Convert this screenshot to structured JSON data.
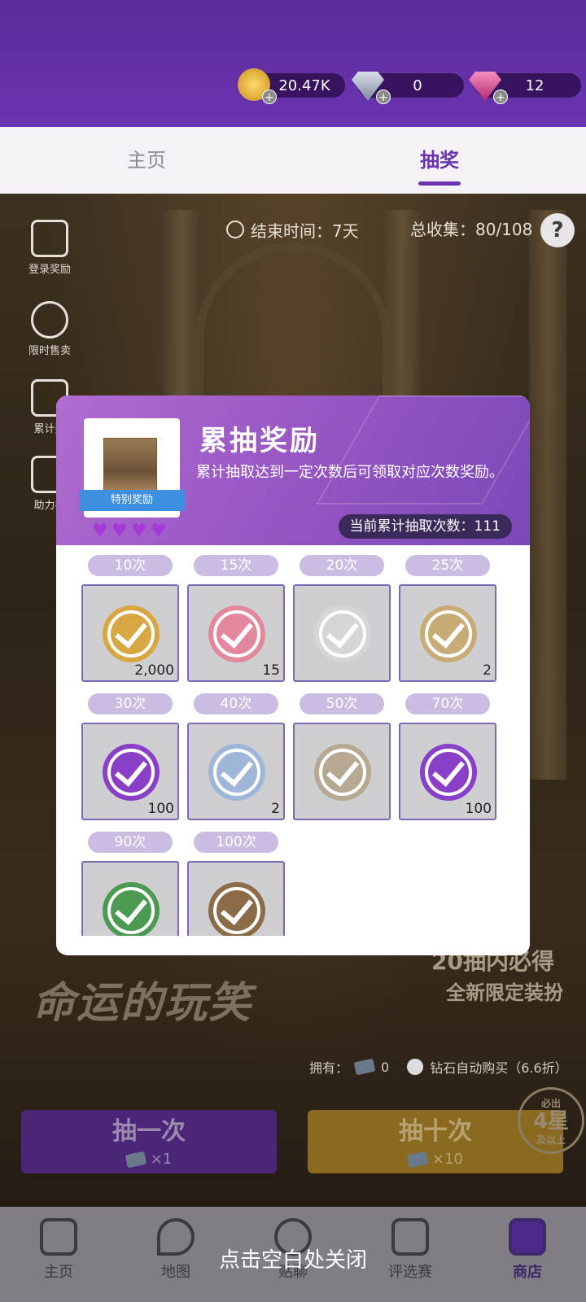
{
  "currencies": [
    {
      "name": "gold-coin",
      "value": "20.47K",
      "color": "#e7b43a"
    },
    {
      "name": "diamond",
      "value": "0",
      "color": "#b8c4d8"
    },
    {
      "name": "gem",
      "value": "12",
      "color": "#e06aa4"
    }
  ],
  "tabs": [
    {
      "label": "主页",
      "active": false
    },
    {
      "label": "抽奖",
      "active": true
    }
  ],
  "event": {
    "end_time": "结束时间：7天",
    "collection": "总收集：80/108",
    "help": "?"
  },
  "side_buttons": [
    {
      "label": "登录奖励",
      "icon": "calendar-check-icon"
    },
    {
      "label": "限时售卖",
      "icon": "timer-icon"
    },
    {
      "label": "累计奖",
      "icon": "gift-icon"
    },
    {
      "label": "助力礼",
      "icon": "gacha-ticket-icon"
    }
  ],
  "modal": {
    "title": "累抽奖励",
    "description": "累计抽取达到一定次数后可领取对应次数奖励。",
    "ribbon": "特别奖励",
    "hearts": 4,
    "count_text": "当前累计抽取次数：111",
    "rewards": [
      {
        "threshold": "10次",
        "qty": "2,000",
        "item": "gold-coin-icon",
        "color": "#d7a742"
      },
      {
        "threshold": "15次",
        "qty": "15",
        "item": "pink-ticket-icon",
        "color": "#e3889c"
      },
      {
        "threshold": "20次",
        "qty": "",
        "item": "silver-headpiece-icon",
        "color": "#d6d6d6"
      },
      {
        "threshold": "25次",
        "qty": "2",
        "item": "perfume-bottle-icon",
        "color": "#c8ac78"
      },
      {
        "threshold": "30次",
        "qty": "100",
        "item": "purple-gem-icon",
        "color": "#8a3fc8"
      },
      {
        "threshold": "40次",
        "qty": "2",
        "item": "blue-perfume-icon",
        "color": "#9fb6d8"
      },
      {
        "threshold": "50次",
        "qty": "",
        "item": "dog-pet-icon",
        "color": "#b7a892"
      },
      {
        "threshold": "70次",
        "qty": "100",
        "item": "purple-gem-icon",
        "color": "#8a3fc8"
      },
      {
        "threshold": "90次",
        "qty": "",
        "item": "green-bag-icon",
        "color": "#4c9a52"
      },
      {
        "threshold": "100次",
        "qty": "",
        "item": "scene-card-icon",
        "color": "#8c6c48"
      }
    ]
  },
  "promo": {
    "line1": "20抽内必得",
    "line2": "全新限定装扮",
    "logo": "命运的玩笑"
  },
  "own": {
    "label": "拥有：",
    "count": "0",
    "auto_buy": "钻石自动购买（6.6折）"
  },
  "draw_buttons": [
    {
      "label": "抽一次",
      "cost": "×1"
    },
    {
      "label": "抽十次",
      "cost": "×10"
    }
  ],
  "badge": {
    "top": "必出",
    "big": "4星",
    "bottom": "及以上"
  },
  "bottom_nav": [
    {
      "label": "主页",
      "icon": "home-icon",
      "active": false
    },
    {
      "label": "地图",
      "icon": "map-pin-icon",
      "active": false
    },
    {
      "label": "贴聊",
      "icon": "chat-icon",
      "active": false
    },
    {
      "label": "评选赛",
      "icon": "trophy-icon",
      "active": false
    },
    {
      "label": "商店",
      "icon": "cart-icon",
      "active": true
    }
  ],
  "close_hint": "点击空白处关闭"
}
